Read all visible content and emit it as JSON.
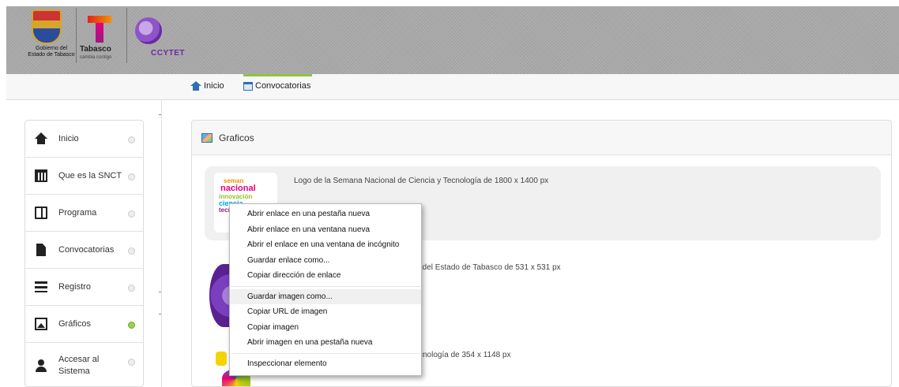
{
  "header": {
    "gobierno_line1": "Gobierno del",
    "gobierno_line2": "Estado de Tabasco",
    "tabasco_name": "Tabasco",
    "tabasco_tagline": "cambia contigo",
    "ccytet_name": "CCYTET"
  },
  "nav": {
    "inicio": "Inicio",
    "convocatorias": "Convocatorias",
    "active_color": "#8fc43c"
  },
  "sidebar": {
    "items": [
      {
        "label": "Inicio",
        "icon": "house-icon"
      },
      {
        "label": "Que es la SNCT",
        "icon": "calendar-icon"
      },
      {
        "label": "Programa",
        "icon": "book-icon"
      },
      {
        "label": "Convocatorias",
        "icon": "document-icon"
      },
      {
        "label": "Registro",
        "icon": "list-icon"
      },
      {
        "label": "Gráficos",
        "icon": "image-icon",
        "active": true
      },
      {
        "label": "Accesar al Sistema",
        "icon": "user-icon"
      }
    ]
  },
  "panel": {
    "title": "Graficos",
    "item1_text": "Logo de la Semana Nacional de Ciencia y Tecnología de 1800 x 1400 px",
    "item2_text": "gía del Estado de Tabasco de 531 x 531 px",
    "item3_text": "cnología de 354 x 1148 px",
    "thumb_words": [
      "seman",
      "nacional",
      "innovación",
      "ciencia",
      "tecnología"
    ]
  },
  "context_menu": {
    "group1": [
      "Abrir enlace en una pestaña nueva",
      "Abrir enlace en una ventana nueva",
      "Abrir el enlace en una ventana de incógnito",
      "Guardar enlace como...",
      "Copiar dirección de enlace"
    ],
    "group2": [
      "Guardar imagen como...",
      "Copiar URL de imagen",
      "Copiar imagen",
      "Abrir imagen en una pestaña nueva"
    ],
    "group3": [
      "Inspeccionar elemento"
    ]
  }
}
